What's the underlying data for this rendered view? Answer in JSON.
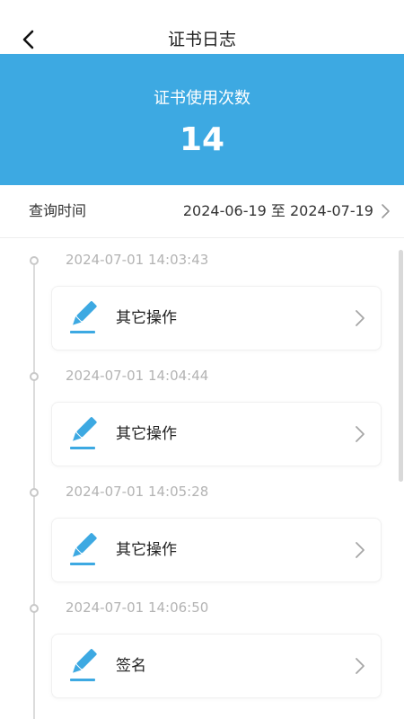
{
  "nav": {
    "back_icon": "chevron-left-icon",
    "title": "证书日志"
  },
  "banner": {
    "label": "证书使用次数",
    "count": "14",
    "background": "#3DA9E2"
  },
  "query": {
    "label": "查询时间",
    "range": "2024-06-19 至 2024-07-19",
    "chevron_icon": "chevron-right-icon"
  },
  "entries": [
    {
      "timestamp": "2024-07-01 14:03:43",
      "action": "其它操作",
      "icon": "pencil-icon"
    },
    {
      "timestamp": "2024-07-01 14:04:44",
      "action": "其它操作",
      "icon": "pencil-icon"
    },
    {
      "timestamp": "2024-07-01 14:05:28",
      "action": "其它操作",
      "icon": "pencil-icon"
    },
    {
      "timestamp": "2024-07-01 14:06:50",
      "action": "签名",
      "icon": "pencil-icon"
    }
  ],
  "colors": {
    "accent": "#3DA9E2",
    "timestamp": "#B3B3B3",
    "timeline": "#DCDCDC"
  }
}
